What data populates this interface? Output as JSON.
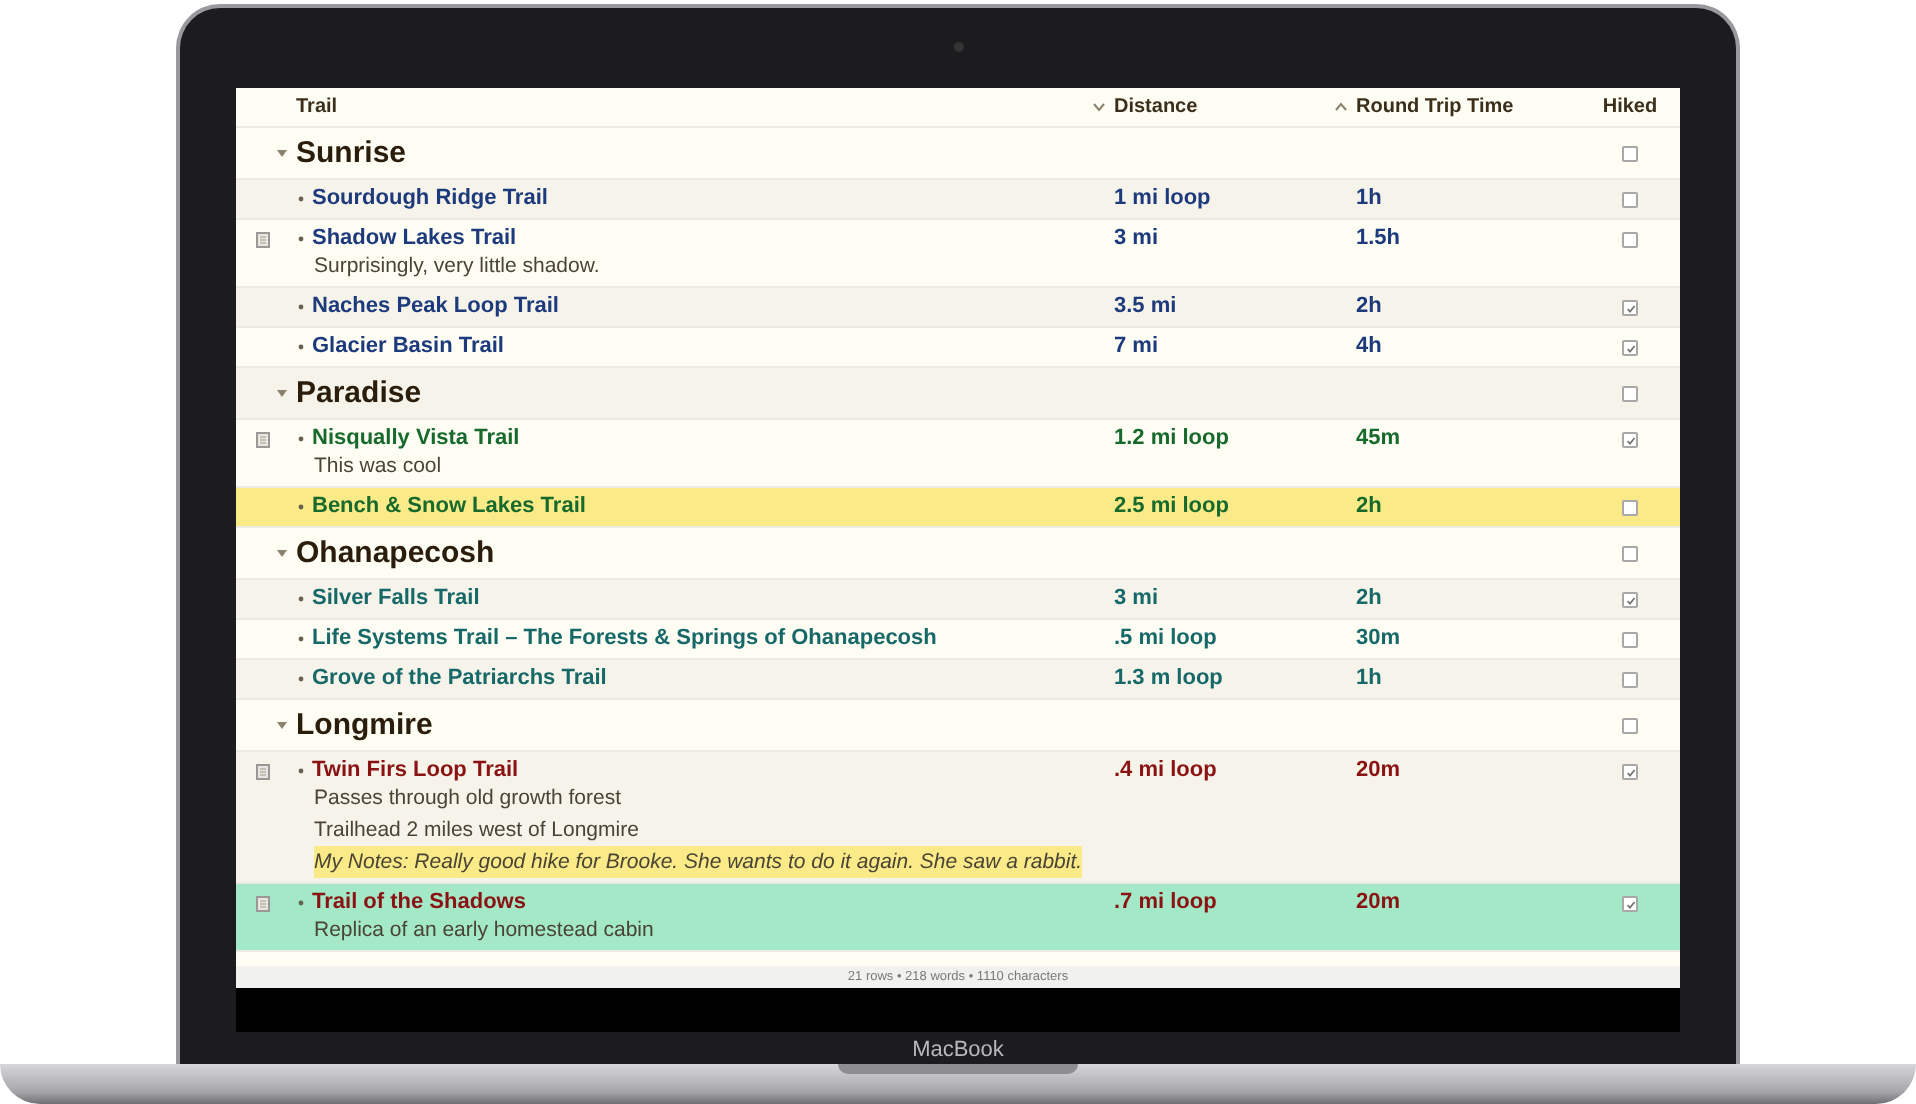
{
  "columns": [
    {
      "label": "Trail",
      "sorted": false
    },
    {
      "label": "Distance",
      "sorted": true,
      "descending": true
    },
    {
      "label": "Round Trip Time",
      "sorted": true,
      "descending": false
    },
    {
      "label": "Hiked",
      "sorted": false
    }
  ],
  "groups": [
    {
      "title": "Sunrise",
      "expanded": true,
      "checked": false,
      "color": "#1d3a7c",
      "trails": [
        {
          "name": "Sourdough Ridge Trail",
          "distance": "1 mi loop",
          "time": "1h",
          "checked": false
        },
        {
          "name": "Shadow Lakes Trail",
          "distance": "3 mi",
          "time": "1.5h",
          "checked": false,
          "notes": [
            {
              "kind": "plain",
              "text": "Surprisingly, very little shadow."
            }
          ]
        },
        {
          "name": "Naches Peak Loop Trail",
          "distance": "3.5 mi",
          "time": "2h",
          "checked": true
        },
        {
          "name": "Glacier Basin Trail",
          "distance": "7 mi",
          "time": "4h",
          "checked": true
        }
      ]
    },
    {
      "title": "Paradise",
      "expanded": true,
      "checked": false,
      "color": "#176a2c",
      "trails": [
        {
          "name": "Nisqually Vista Trail",
          "distance": "1.2 mi loop",
          "time": "45m",
          "checked": true,
          "notes": [
            {
              "kind": "plain",
              "text": "This was cool"
            }
          ]
        },
        {
          "name": "Bench & Snow Lakes Trail",
          "distance": "2.5 mi loop",
          "time": "2h",
          "checked": false,
          "color": "#fbea88"
        }
      ]
    },
    {
      "title": "Ohanapecosh",
      "expanded": true,
      "checked": false,
      "color": "#176868",
      "trails": [
        {
          "name": "Silver Falls Trail",
          "distance": "3 mi",
          "time": "2h",
          "checked": true
        },
        {
          "name": "Life Systems Trail – The Forests & Springs of Ohanapecosh",
          "distance": ".5 mi loop",
          "time": "30m",
          "checked": false
        },
        {
          "name": "Grove of the Patriarchs Trail",
          "distance": "1.3 m loop",
          "time": "1h",
          "checked": false
        }
      ]
    },
    {
      "title": "Longmire",
      "expanded": true,
      "checked": false,
      "color": "#8a1212",
      "trails": [
        {
          "name": "Twin Firs Loop Trail",
          "distance": ".4 mi loop",
          "time": "20m",
          "checked": true,
          "notes": [
            {
              "kind": "plain",
              "text": "Passes through old growth forest"
            },
            {
              "kind": "plain",
              "text": "Trailhead 2 miles west of Longmire"
            },
            {
              "kind": "highlighted",
              "text": "My Notes: Really good hike for Brooke. She wants to do it again. She saw a rabbit."
            }
          ]
        },
        {
          "name": "Trail of the Shadows",
          "distance": ".7 mi loop",
          "time": "20m",
          "checked": true,
          "color": "#a3e9c8",
          "notes": [
            {
              "kind": "plain",
              "text": "Replica of an early homestead cabin"
            }
          ]
        }
      ]
    }
  ],
  "status_bar": "21 rows • 218 words • 1110 characters",
  "device_label": "MacBook"
}
